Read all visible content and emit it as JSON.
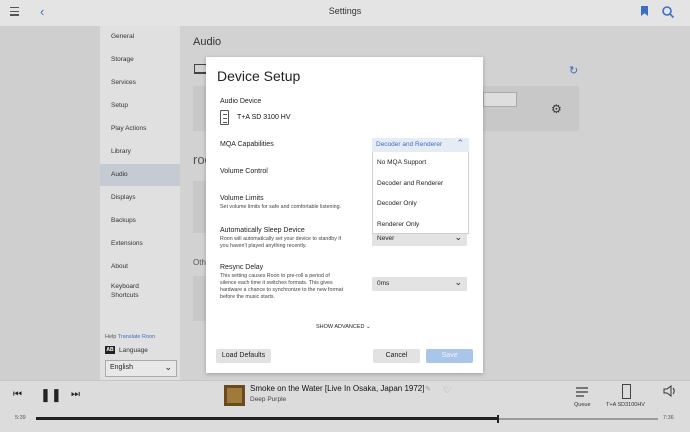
{
  "topbar": {
    "title": "Settings"
  },
  "sidebar": {
    "items": [
      {
        "label": "General"
      },
      {
        "label": "Storage"
      },
      {
        "label": "Services"
      },
      {
        "label": "Setup"
      },
      {
        "label": "Play Actions"
      },
      {
        "label": "Library"
      },
      {
        "label": "Audio"
      },
      {
        "label": "Displays"
      },
      {
        "label": "Backups"
      },
      {
        "label": "Extensions"
      },
      {
        "label": "About"
      },
      {
        "label": "Keyboard Shortcuts"
      }
    ],
    "help_label": "Help",
    "help_link": "Translate Roon",
    "language_badge": "AB",
    "language_label": "Language",
    "language_value": "English"
  },
  "main": {
    "title": "Audio",
    "roon_label": "roo",
    "other_label": "Oth"
  },
  "dialog": {
    "title": "Device Setup",
    "audio_device_label": "Audio Device",
    "device_name": "T+A SD 3100 HV",
    "mqa_label": "MQA Capabilities",
    "mqa_value": "Decoder and Renderer",
    "mqa_options": [
      "No MQA Support",
      "Decoder and Renderer",
      "Decoder Only",
      "Renderer Only"
    ],
    "volume_control_label": "Volume Control",
    "volume_limits_label": "Volume Limits",
    "volume_limits_desc": "Set volume limits for safe and comfortable listening.",
    "sleep_label": "Automatically Sleep Device",
    "sleep_desc_1": "Roon will automatically set your device to standby if",
    "sleep_desc_2": "you haven't played anything recently.",
    "sleep_value": "Never",
    "resync_label": "Resync Delay",
    "resync_desc_1": "This setting causes Roon to pre-roll a period of",
    "resync_desc_2": "silence each time it switches formats. This gives",
    "resync_desc_3": "hardware a chance to synchronize to the new format",
    "resync_desc_4": "before the music starts.",
    "resync_value": "0ms",
    "show_advanced": "SHOW ADVANCED",
    "load_defaults": "Load Defaults",
    "cancel": "Cancel",
    "save": "Save"
  },
  "player": {
    "song_title": "Smoke on the Water [Live In Osaka, Japan 1972]",
    "artist": "Deep Purple",
    "queue_label": "Queue",
    "zone_label": "T+A SD3100HV",
    "elapsed": "5:39",
    "duration": "7:36",
    "progress": 0.743
  },
  "colors": {
    "accent": "#3a6fc4",
    "save_disabled": "#a9c6ea"
  }
}
